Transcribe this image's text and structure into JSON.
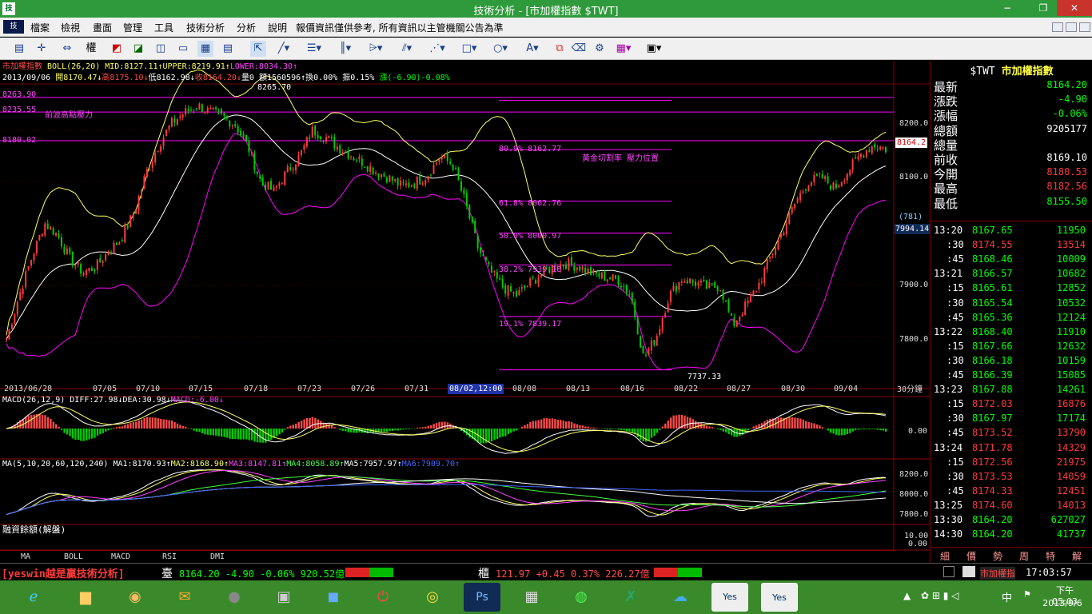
{
  "window": {
    "title": "技術分析 - [市加權指數 $TWT]",
    "app_icon": "技",
    "min": "−",
    "restore": "❐",
    "close": "✕"
  },
  "menu": [
    "檔案",
    "檢視",
    "畫面",
    "管理",
    "工具",
    "技術分析",
    "分析",
    "說明",
    "報價資訊僅供參考, 所有資訊以主管機關公告為準"
  ],
  "toolbar_icons": [
    "print-icon",
    "crosshair-icon",
    "weight-icon",
    "chart-a-icon",
    "chart-b-icon",
    "chart-c-icon",
    "chart-d-icon",
    "chart-e-icon",
    "cursor-icon",
    "line-tool-icon",
    "horizontal-line-icon",
    "vertical-lines-icon",
    "fan-icon",
    "parallel-lines-icon",
    "channel-icon",
    "rectangle-icon",
    "ellipse-icon",
    "text-icon",
    "copy-icon",
    "eraser-icon",
    "settings-icon",
    "palette-icon",
    "save-icon"
  ],
  "toolbar_weight_label": "權",
  "main": {
    "line1_name": "市加權指數",
    "line1_boll": " BOLL(26,20) MID:8127.11↑UPPER:8219.91↑",
    "line1_lower": "LOWER:8034.30↑",
    "line2_date": "2013/09/06",
    "line2_open": "開8170.47↓",
    "line2_high": "高8175.10↓",
    "line2_low": "低8162.98↓",
    "line2_close": "收8164.20↓",
    "line2_rest": "量0 額1560596↑換0.00% 振0.15%",
    "line2_chg": "漲(-6.90)-0.08%",
    "h_levels": [
      "8263.90",
      "8235.55",
      "8180.02"
    ],
    "note_prev_high": "前波高點壓力",
    "note_golden": "黃金切割率 壓力位置",
    "peak_label": "8265.70",
    "trough_label": "7737.33",
    "fib": [
      "80.9% 8162.77",
      "61.8% 8062.76",
      "50.0% 8000.97",
      "38.2% 7939.18",
      "19.1% 7839.17"
    ],
    "yaxis": [
      "8200.0",
      "8100.0",
      "7900.0",
      "7800.0"
    ],
    "last_price_tag": "8164.2",
    "tag_781": "(781)",
    "tag_7994": "7994.14",
    "xaxis": [
      "2013/06/28",
      "07/05",
      "07/10",
      "07/15",
      "07/18",
      "07/23",
      "07/26",
      "07/31",
      "08/02,12:00",
      "08/08",
      "08/13",
      "08/16",
      "08/22",
      "08/27",
      "08/30",
      "09/04"
    ],
    "period": "30分鐘"
  },
  "macd": {
    "label": "MACD(26,12,9) DIFF:27.98↓DEA:30.98↓",
    "macd_part": "MACD:-6.00↓",
    "zero": "0.00"
  },
  "ma": {
    "label": "MA(5,10,20,60,120,240) ",
    "ma1": "MA1:8170.93↑",
    "ma2": "MA2:8168.90↑",
    "ma3": "MA3:8147.81↑",
    "ma4": "MA4:8058.89↑",
    "ma5": "MA5:7957.97↑",
    "ma6": "MA6:7909.70↑",
    "yaxis": [
      "8200.0",
      "8000.0",
      "7800.0"
    ]
  },
  "margin": {
    "label": "融資餘額(解盤)",
    "yaxis": [
      "10.00",
      "0.00"
    ]
  },
  "bottom_tabs": [
    "MA",
    "BOLL",
    "MACD",
    "RSI",
    "DMI"
  ],
  "quote": {
    "symbol": "$TWT",
    "name": "市加權指數",
    "rows": [
      {
        "label": "最新",
        "value": "8164.20",
        "color": "#00ff00"
      },
      {
        "label": "漲跌",
        "value": "-4.90",
        "color": "#00ff00"
      },
      {
        "label": "漲幅",
        "value": "-0.06%",
        "color": "#00ff00"
      },
      {
        "label": "總額",
        "value": "9205177",
        "color": "#ffffff"
      },
      {
        "label": "總量",
        "value": "",
        "color": "#ffffff"
      },
      {
        "label": "前收",
        "value": "8169.10",
        "color": "#ffffff"
      },
      {
        "label": "今開",
        "value": "8180.53",
        "color": "#ff3a3a"
      },
      {
        "label": "最高",
        "value": "8182.56",
        "color": "#ff3a3a"
      },
      {
        "label": "最低",
        "value": "8155.50",
        "color": "#00ff00"
      }
    ],
    "ticks": [
      {
        "time": "13:20",
        "price": "8167.65",
        "vol": "11950",
        "hour": true
      },
      {
        "time": ":30",
        "price": "8174.55",
        "vol": "13514",
        "hour": false
      },
      {
        "time": ":45",
        "price": "8168.46",
        "vol": "10009",
        "hour": false
      },
      {
        "time": "13:21",
        "price": "8166.57",
        "vol": "10682",
        "hour": true
      },
      {
        "time": ":15",
        "price": "8165.61",
        "vol": "12852",
        "hour": false
      },
      {
        "time": ":30",
        "price": "8165.54",
        "vol": "10532",
        "hour": false
      },
      {
        "time": ":45",
        "price": "8165.36",
        "vol": "12124",
        "hour": false
      },
      {
        "time": "13:22",
        "price": "8168.40",
        "vol": "11910",
        "hour": true
      },
      {
        "time": ":15",
        "price": "8167.66",
        "vol": "12632",
        "hour": false
      },
      {
        "time": ":30",
        "price": "8166.18",
        "vol": "10159",
        "hour": false
      },
      {
        "time": ":45",
        "price": "8166.39",
        "vol": "15085",
        "hour": false
      },
      {
        "time": "13:23",
        "price": "8167.88",
        "vol": "14261",
        "hour": true
      },
      {
        "time": ":15",
        "price": "8172.03",
        "vol": "16876",
        "hour": false
      },
      {
        "time": ":30",
        "price": "8167.97",
        "vol": "17174",
        "hour": false
      },
      {
        "time": ":45",
        "price": "8173.52",
        "vol": "13790",
        "hour": false
      },
      {
        "time": "13:24",
        "price": "8171.78",
        "vol": "14329",
        "hour": true
      },
      {
        "time": ":15",
        "price": "8172.56",
        "vol": "21975",
        "hour": false
      },
      {
        "time": ":30",
        "price": "8173.53",
        "vol": "14059",
        "hour": false
      },
      {
        "time": ":45",
        "price": "8174.33",
        "vol": "12451",
        "hour": false
      },
      {
        "time": "13:25",
        "price": "8174.60",
        "vol": "14013",
        "hour": true
      },
      {
        "time": "13:30",
        "price": "8164.20",
        "vol": "627027",
        "hour": true
      },
      {
        "time": "14:30",
        "price": "8164.20",
        "vol": "41737",
        "hour": true
      }
    ],
    "tabs": [
      "細",
      "價",
      "勢",
      "周",
      "特",
      "解"
    ]
  },
  "statusbar": {
    "brand": "[yeswin越是贏技術分析]",
    "tw_label": "臺",
    "tw_quote": "8164.20 -4.90 -0.06% 920.52億",
    "otc_label": "櫃",
    "otc_quote": "121.97 +0.45 0.37% 226.27億",
    "right_name": "市加權指",
    "time": "17:03:57"
  },
  "taskbar": {
    "apps": [
      "ie-icon",
      "explorer-icon",
      "media-icon",
      "outlook-icon",
      "speaker-icon",
      "doc-icon",
      "app-icon",
      "power-icon",
      "chrome-icon",
      "photoshop-icon",
      "calculator-icon",
      "line-icon",
      "excel-icon",
      "onedrive-icon",
      "yeswin-icon",
      "yeswin2-icon"
    ],
    "ime": "中",
    "clock_time": "下午 05:03",
    "clock_date": "2013/9/6"
  },
  "chart_data": [
    {
      "type": "candlestick",
      "title": "市加權指數 $TWT",
      "series": [
        {
          "name": "BOLL UPPER",
          "latest": 8219.91
        },
        {
          "name": "BOLL MID",
          "latest": 8127.11
        },
        {
          "name": "BOLL LOWER",
          "latest": 8034.3
        }
      ],
      "close_path": [
        7795,
        7880,
        7955,
        8020,
        7998,
        7950,
        7925,
        7935,
        7965,
        7990,
        8040,
        8120,
        8175,
        8215,
        8235,
        8248,
        8236,
        8226,
        8210,
        8165,
        8098,
        8082,
        8120,
        8150,
        8200,
        8188,
        8168,
        8152,
        8138,
        8120,
        8108,
        8092,
        8098,
        8112,
        8148,
        8135,
        8060,
        7972,
        7925,
        7895,
        7880,
        7902,
        7922,
        7938,
        7942,
        7935,
        7922,
        7915,
        7910,
        7880,
        7758,
        7800,
        7880,
        7912,
        7905,
        7895,
        7898,
        7822,
        7860,
        7900,
        7958,
        8010,
        8065,
        8102,
        8108,
        8088,
        8120,
        8152,
        8172,
        8164
      ],
      "h_lines": [
        8263.9,
        8235.55,
        8180.02
      ],
      "fibonacci": [
        {
          "level": "80.9%",
          "value": 8162.77
        },
        {
          "level": "61.8%",
          "value": 8062.76
        },
        {
          "level": "50.0%",
          "value": 8000.97
        },
        {
          "level": "38.2%",
          "value": 7939.18
        },
        {
          "level": "19.1%",
          "value": 7839.17
        }
      ],
      "peak": 8265.7,
      "trough": 7737.33,
      "ylim": [
        7715,
        8290
      ],
      "last": 8164.2
    },
    {
      "type": "bar",
      "title": "MACD(26,12,9)",
      "series": [
        {
          "name": "DIFF",
          "latest": 27.98
        },
        {
          "name": "DEA",
          "latest": 30.98
        },
        {
          "name": "MACD",
          "latest": -6.0
        }
      ],
      "zero_line": 0.0
    },
    {
      "type": "line",
      "title": "MA(5,10,20,60,120,240)",
      "series": [
        {
          "name": "MA1",
          "latest": 8170.93
        },
        {
          "name": "MA2",
          "latest": 8168.9
        },
        {
          "name": "MA3",
          "latest": 8147.81
        },
        {
          "name": "MA4",
          "latest": 8058.89
        },
        {
          "name": "MA5",
          "latest": 7957.97
        },
        {
          "name": "MA6",
          "latest": 7909.7
        }
      ],
      "ylim": [
        7750,
        8250
      ]
    }
  ],
  "colors": {
    "up": "#ff3a3a",
    "down": "#00cc00",
    "magenta": "#ff00ff",
    "yellow": "#ffff66",
    "grid": "#8b0000",
    "title_bg": "#2f9a3b"
  }
}
